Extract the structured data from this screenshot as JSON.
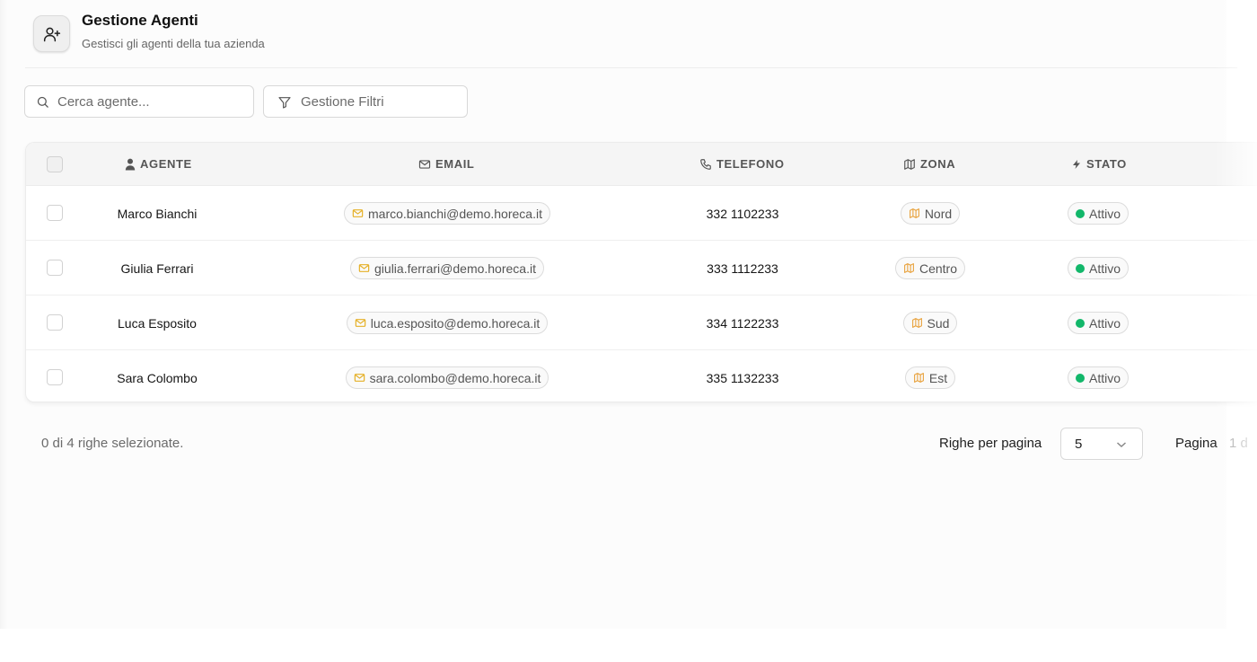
{
  "header": {
    "title": "Gestione Agenti",
    "subtitle": "Gestisci gli agenti della tua azienda",
    "icon": "user-plus-icon"
  },
  "toolbar": {
    "search_placeholder": "Cerca agente...",
    "filter_label": "Gestione Filtri"
  },
  "table": {
    "columns": [
      {
        "label": "AGENTE",
        "icon": "user-icon"
      },
      {
        "label": "EMAIL",
        "icon": "mail-icon"
      },
      {
        "label": "TELEFONO",
        "icon": "phone-icon"
      },
      {
        "label": "ZONA",
        "icon": "map-icon"
      },
      {
        "label": "STATO",
        "icon": "zap-icon"
      }
    ],
    "rows": [
      {
        "agente": "Marco Bianchi",
        "email": "marco.bianchi@demo.horeca.it",
        "telefono": "332 1102233",
        "zona": "Nord",
        "stato": "Attivo"
      },
      {
        "agente": "Giulia Ferrari",
        "email": "giulia.ferrari@demo.horeca.it",
        "telefono": "333 1112233",
        "zona": "Centro",
        "stato": "Attivo"
      },
      {
        "agente": "Luca Esposito",
        "email": "luca.esposito@demo.horeca.it",
        "telefono": "334 1122233",
        "zona": "Sud",
        "stato": "Attivo"
      },
      {
        "agente": "Sara Colombo",
        "email": "sara.colombo@demo.horeca.it",
        "telefono": "335 1132233",
        "zona": "Est",
        "stato": "Attivo"
      }
    ]
  },
  "footer": {
    "selection_text": "0 di 4 righe selezionate.",
    "rows_per_page_label": "Righe per pagina",
    "rows_per_page_value": "5",
    "page_label": "Pagina",
    "page_number": "1 d"
  },
  "colors": {
    "status_active": "#12b76a",
    "mail_icon": "#e5b027",
    "zone_icon": "#e8a13a"
  }
}
